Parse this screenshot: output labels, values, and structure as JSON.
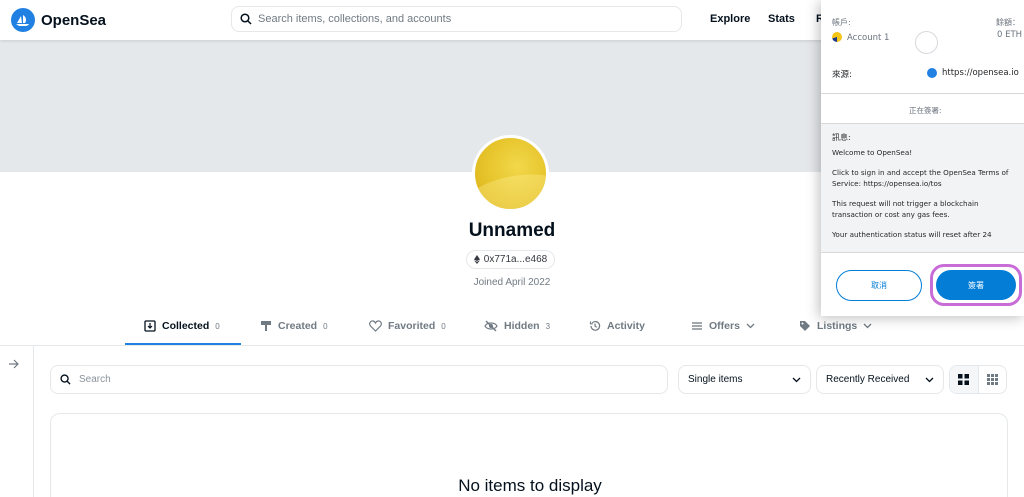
{
  "nav": {
    "brand": "OpenSea",
    "search_placeholder": "Search items, collections, and accounts",
    "links": [
      "Explore",
      "Stats",
      "R"
    ]
  },
  "profile": {
    "name": "Unnamed",
    "address": "0x771a...e468",
    "joined": "Joined April 2022"
  },
  "tabs": [
    {
      "label": "Collected",
      "count": "0"
    },
    {
      "label": "Created",
      "count": "0"
    },
    {
      "label": "Favorited",
      "count": "0"
    },
    {
      "label": "Hidden",
      "count": "3"
    },
    {
      "label": "Activity"
    },
    {
      "label": "Offers"
    },
    {
      "label": "Listings"
    }
  ],
  "filters": {
    "search_placeholder": "Search",
    "items_select": "Single items",
    "sort_select": "Recently Received"
  },
  "empty_text": "No items to display",
  "popup": {
    "account_label": "帳戶:",
    "account_name": "Account 1",
    "balance_label": "餘額：",
    "balance_value": "0 ETH",
    "origin_label": "來源:",
    "origin_value": "https://opensea.io",
    "signing_label": "正在簽署:",
    "message_label": "訊息:",
    "message_lines": [
      "Welcome to OpenSea!",
      "Click to sign in and accept the OpenSea Terms of Service: https://opensea.io/tos",
      "This request will not trigger a blockchain transaction or cost any gas fees.",
      "Your authentication status will reset after 24"
    ],
    "cancel_label": "取消",
    "sign_label": "簽署"
  },
  "colors": {
    "accent": "#2081e2",
    "metamask_blue": "#037dd6",
    "highlight": "#c86dd7"
  }
}
